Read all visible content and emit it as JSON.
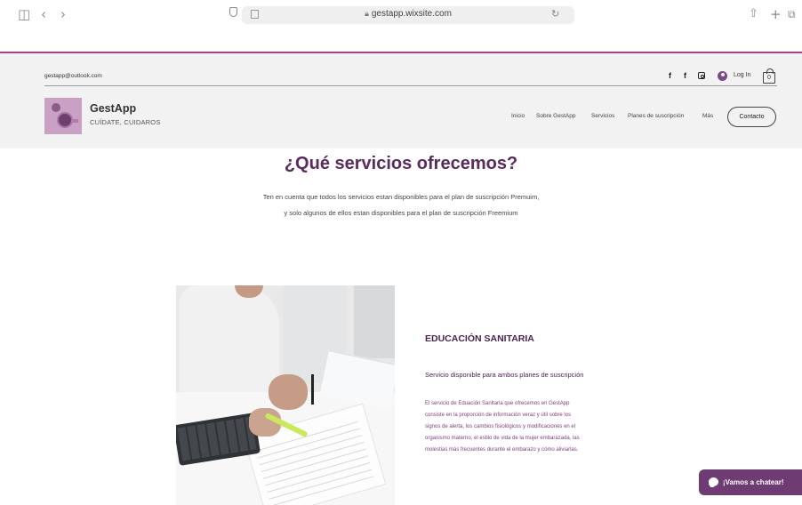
{
  "browser": {
    "url": "gestapp.wixsite.com",
    "icons": [
      "sidebar-icon",
      "back-icon",
      "forward-icon",
      "shield-icon",
      "reader-icon",
      "lock-icon",
      "reload-icon",
      "share-icon",
      "new-tab-icon",
      "tabs-icon"
    ]
  },
  "header": {
    "email": "gestapp@outlook.com",
    "social": [
      "facebook-icon",
      "facebook-icon",
      "instagram-icon"
    ],
    "login_label": "Log In",
    "cart_count": "0",
    "brand_name": "GestApp",
    "tagline": "CUÍDATE, CUIDAROS",
    "nav": [
      "Inicio",
      "Sobre GestApp",
      "Servicios",
      "Planes de suscripción",
      "Más"
    ],
    "contact_label": "Contacto",
    "accent_color": "#a0438f"
  },
  "main": {
    "title": "¿Qué servicios ofrecemos?",
    "intro_lines": [
      "Ten en cuenta que todos los servicios estan disponibles para el plan de suscripción Premuim,",
      "y solo algunos de ellos estan disponibles para el plan de suscripción Freemium"
    ],
    "service": {
      "title": "EDUCACIÓN SANITARIA",
      "subtitle": "Servicio disponible para ambos planes de suscripción",
      "description_lines": [
        "El servicio de Eduación Sanitaria que ofrecemos en GestApp",
        "consiste en la proporción de información veraz y útil sobre los",
        "signos de alerta, los cambios fisiológicos y modificaciones en el",
        "organismo materno, el estilo de vida de la mujer embarazada, las",
        "molestias más frecuentes durante el embarazo y cómo aliviarlas."
      ]
    }
  },
  "chat": {
    "label": "¡Vamos a chatear!",
    "color": "#6f3b73"
  }
}
